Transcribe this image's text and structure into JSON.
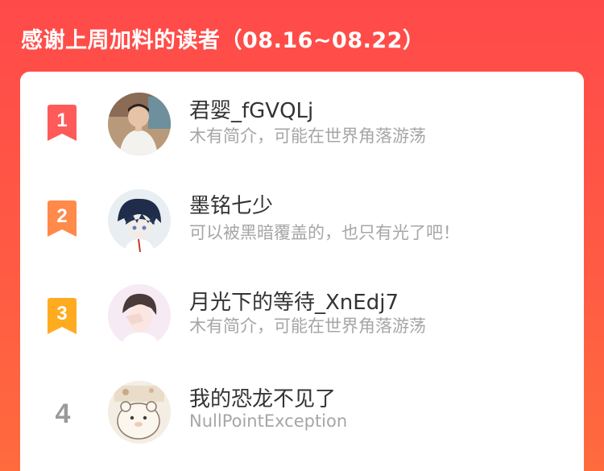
{
  "header": {
    "title": "感谢上周加料的读者（08.16~08.22）"
  },
  "colors": {
    "background": "#ff4a4a",
    "rank1": "#ff5a5a",
    "rank2": "#ff8a4a",
    "rank3": "#ffab1f",
    "rank_plain": "#9a9a9a"
  },
  "readers": [
    {
      "rank": "1",
      "name": "君婴_fGVQLj",
      "bio": "木有简介，可能在世界角落游荡"
    },
    {
      "rank": "2",
      "name": "墨铭七少",
      "bio": "可以被黑暗覆盖的，也只有光了吧！"
    },
    {
      "rank": "3",
      "name": "月光下的等待_XnEdj7",
      "bio": "木有简介，可能在世界角落游荡"
    },
    {
      "rank": "4",
      "name": "我的恐龙不见了",
      "bio": "NullPointException"
    }
  ]
}
